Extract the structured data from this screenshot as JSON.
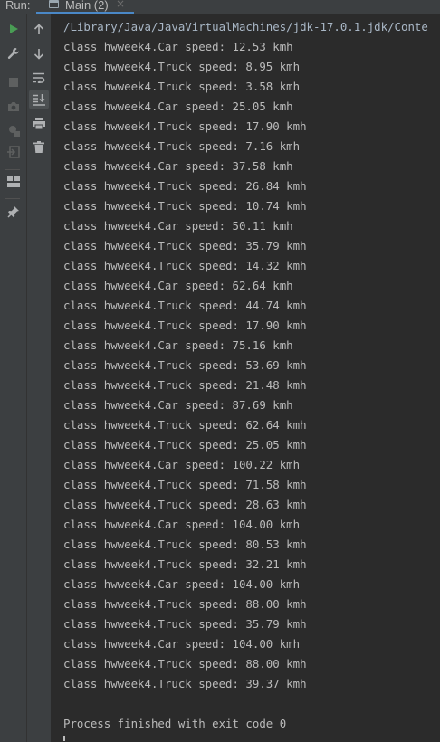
{
  "tool_window": {
    "title": "Run:",
    "tab": {
      "label": "Main (2)",
      "close_glyph": "×",
      "icon": "application-icon"
    }
  },
  "toolbar_left": [
    {
      "name": "rerun-icon",
      "color": "#499c54"
    },
    {
      "name": "wrench-icon",
      "color": "#afb1b3"
    },
    {
      "name": "stop-icon",
      "color": "#5e6060"
    },
    {
      "name": "camera-icon",
      "color": "#5e6060"
    },
    {
      "name": "debug-settings-icon",
      "color": "#5e6060"
    },
    {
      "name": "exit-icon",
      "color": "#5e6060"
    },
    {
      "name": "layout-icon",
      "color": "#afb1b3"
    },
    {
      "name": "pin-icon",
      "color": "#afb1b3"
    }
  ],
  "toolbar_right": [
    {
      "name": "arrow-up-icon"
    },
    {
      "name": "arrow-down-icon"
    },
    {
      "name": "soft-wrap-icon"
    },
    {
      "name": "scroll-to-end-icon"
    },
    {
      "name": "print-icon"
    },
    {
      "name": "trash-icon"
    }
  ],
  "console": {
    "command": "/Library/Java/JavaVirtualMachines/jdk-17.0.1.jdk/Conte",
    "lines": [
      "class hwweek4.Car speed: 12.53 kmh",
      "class hwweek4.Truck speed: 8.95 kmh",
      "class hwweek4.Truck speed: 3.58 kmh",
      "class hwweek4.Car speed: 25.05 kmh",
      "class hwweek4.Truck speed: 17.90 kmh",
      "class hwweek4.Truck speed: 7.16 kmh",
      "class hwweek4.Car speed: 37.58 kmh",
      "class hwweek4.Truck speed: 26.84 kmh",
      "class hwweek4.Truck speed: 10.74 kmh",
      "class hwweek4.Car speed: 50.11 kmh",
      "class hwweek4.Truck speed: 35.79 kmh",
      "class hwweek4.Truck speed: 14.32 kmh",
      "class hwweek4.Car speed: 62.64 kmh",
      "class hwweek4.Truck speed: 44.74 kmh",
      "class hwweek4.Truck speed: 17.90 kmh",
      "class hwweek4.Car speed: 75.16 kmh",
      "class hwweek4.Truck speed: 53.69 kmh",
      "class hwweek4.Truck speed: 21.48 kmh",
      "class hwweek4.Car speed: 87.69 kmh",
      "class hwweek4.Truck speed: 62.64 kmh",
      "class hwweek4.Truck speed: 25.05 kmh",
      "class hwweek4.Car speed: 100.22 kmh",
      "class hwweek4.Truck speed: 71.58 kmh",
      "class hwweek4.Truck speed: 28.63 kmh",
      "class hwweek4.Car speed: 104.00 kmh",
      "class hwweek4.Truck speed: 80.53 kmh",
      "class hwweek4.Truck speed: 32.21 kmh",
      "class hwweek4.Car speed: 104.00 kmh",
      "class hwweek4.Truck speed: 88.00 kmh",
      "class hwweek4.Truck speed: 35.79 kmh",
      "class hwweek4.Car speed: 104.00 kmh",
      "class hwweek4.Truck speed: 88.00 kmh",
      "class hwweek4.Truck speed: 39.37 kmh"
    ],
    "exit_message": "Process finished with exit code 0"
  },
  "colors": {
    "panel_bg": "#3c3f41",
    "console_bg": "#2b2b2b",
    "text": "#bbbbbb",
    "accent": "#4a88c7",
    "run_green": "#499c54"
  }
}
